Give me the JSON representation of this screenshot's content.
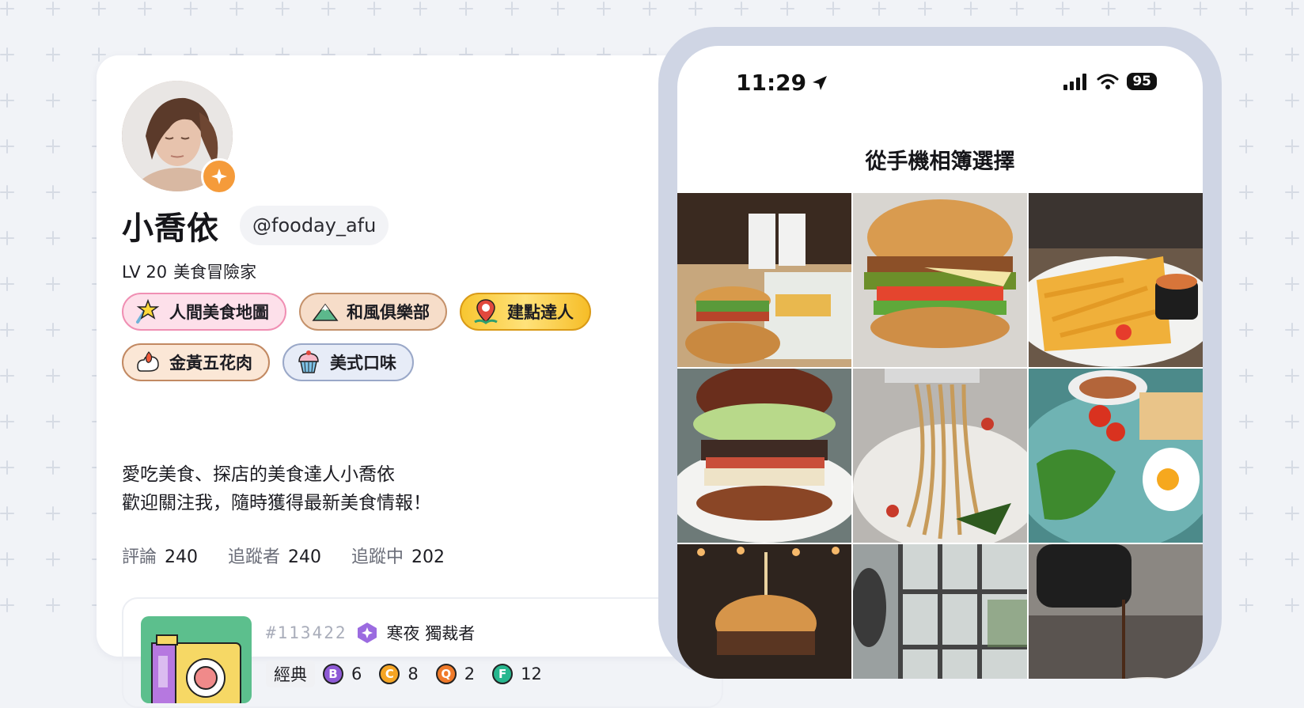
{
  "profile": {
    "display_name": "小喬依",
    "handle": "@fooday_afu",
    "level_code": "LV 20",
    "level_title": "美食冒險家",
    "badges": [
      {
        "label": "人間美食地圖",
        "icon": "star-pennant-icon"
      },
      {
        "label": "和風俱樂部",
        "icon": "mountain-icon"
      },
      {
        "label": "建點達人",
        "icon": "map-pin-icon"
      },
      {
        "label": "金黃五花肉",
        "icon": "flame-pork-icon"
      },
      {
        "label": "美式口味",
        "icon": "cupcake-icon"
      }
    ],
    "bio_line1": "愛吃美食、探店的美食達人小喬依",
    "bio_line2": "歡迎關注我，隨時獲得最新美食情報！",
    "stats": [
      {
        "label": "評論",
        "value": "240"
      },
      {
        "label": "追蹤者",
        "value": "240"
      },
      {
        "label": "追蹤中",
        "value": "202"
      }
    ],
    "card": {
      "post_id": "#113422",
      "rank_name": "寒夜 獨裁者",
      "tag": "經典",
      "scores": [
        {
          "letter": "B",
          "value": "6",
          "color": "#8e5ad6"
        },
        {
          "letter": "C",
          "value": "8",
          "color": "#f5a524"
        },
        {
          "letter": "Q",
          "value": "2",
          "color": "#f07a2a"
        },
        {
          "letter": "F",
          "value": "12",
          "color": "#27b78f"
        }
      ]
    }
  },
  "phone": {
    "time": "11:29",
    "battery": "95",
    "picker_title": "從手機相簿選擇",
    "photos": [
      "burgers-fries-drinks-photo",
      "chicken-burger-photo",
      "fries-plate-photo",
      "tall-burger-photo",
      "spaghetti-fork-photo",
      "breakfast-salad-photo",
      "burger-skewer-photo",
      "window-interior-photo",
      "coffee-pour-photo"
    ]
  }
}
